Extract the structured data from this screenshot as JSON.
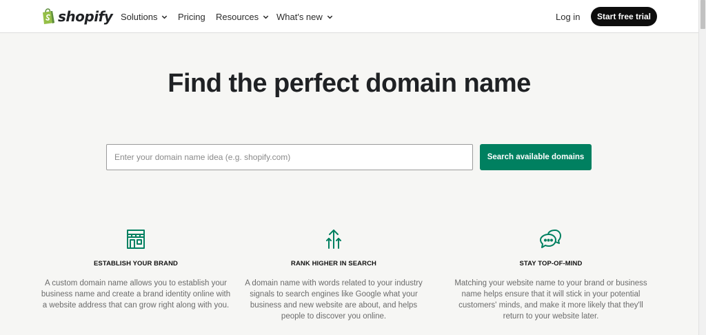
{
  "header": {
    "logo_text": "shopify",
    "nav": [
      {
        "label": "Solutions",
        "has_dropdown": true
      },
      {
        "label": "Pricing",
        "has_dropdown": false
      },
      {
        "label": "Resources",
        "has_dropdown": true
      },
      {
        "label": "What's new",
        "has_dropdown": true
      }
    ],
    "login_label": "Log in",
    "cta_label": "Start free trial"
  },
  "hero": {
    "title": "Find the perfect domain name"
  },
  "search": {
    "placeholder": "Enter your domain name idea (e.g. shopify.com)",
    "value": "",
    "button_label": "Search available domains"
  },
  "features": [
    {
      "icon": "storefront-icon",
      "title": "ESTABLISH YOUR BRAND",
      "text": "A custom domain name allows you to establish your business name and create a brand identity online with a website address that can grow right along with you."
    },
    {
      "icon": "rank-arrows-icon",
      "title": "RANK HIGHER IN SEARCH",
      "text": "A domain name with words related to your industry signals to search engines like Google what your business and new website are about, and helps people to discover you online."
    },
    {
      "icon": "chat-bubbles-icon",
      "title": "STAY TOP-OF-MIND",
      "text": "Matching your website name to your brand or business name helps ensure that it will stick in your potential customers' minds, and make it more likely that they'll return to your website later."
    }
  ],
  "colors": {
    "brand_green": "#008060",
    "logo_green": "#95bf47",
    "background": "#f6f6f4",
    "cta_black": "#0d0d0d"
  }
}
